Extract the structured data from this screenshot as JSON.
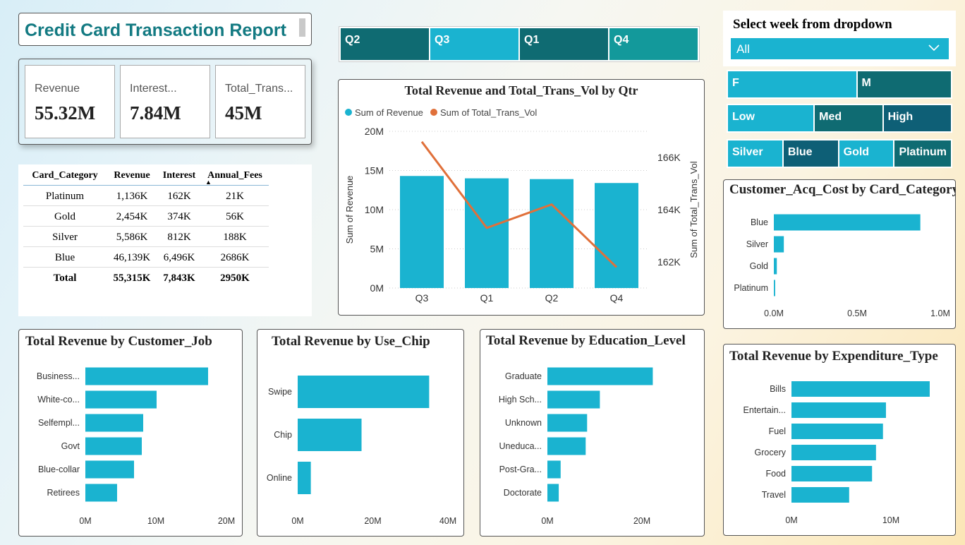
{
  "title": "Credit Card Transaction Report",
  "kpis": [
    {
      "label": "Revenue",
      "value": "55.32M"
    },
    {
      "label": "Interest...",
      "value": "7.84M"
    },
    {
      "label": "Total_Trans...",
      "value": "45M"
    }
  ],
  "matrix": {
    "headers": [
      "Card_Category",
      "Revenue",
      "Interest",
      "Annual_Fees"
    ],
    "sort_indicator": "▲",
    "rows": [
      [
        "Platinum",
        "1,136K",
        "162K",
        "21K"
      ],
      [
        "Gold",
        "2,454K",
        "374K",
        "56K"
      ],
      [
        "Silver",
        "5,586K",
        "812K",
        "188K"
      ],
      [
        "Blue",
        "46,139K",
        "6,496K",
        "2686K"
      ]
    ],
    "total": [
      "Total",
      "55,315K",
      "7,843K",
      "2950K"
    ]
  },
  "quarter_slicer": [
    {
      "label": "Q2",
      "color": "#0f6b72"
    },
    {
      "label": "Q3",
      "color": "#1ab3d0"
    },
    {
      "label": "Q1",
      "color": "#0f6b72"
    },
    {
      "label": "Q4",
      "color": "#13999b"
    }
  ],
  "week_filter": {
    "title": "Select week from dropdown",
    "selected": "All"
  },
  "gender_slicer": [
    {
      "label": "F",
      "color": "#1ab3d0"
    },
    {
      "label": "M",
      "color": "#0f6b72"
    }
  ],
  "income_slicer": [
    {
      "label": "Low",
      "color": "#1ab3d0"
    },
    {
      "label": "Med",
      "color": "#0f6b72"
    },
    {
      "label": "High",
      "color": "#0e5f76"
    }
  ],
  "card_slicer": [
    {
      "label": "Silver",
      "color": "#1ab3d0"
    },
    {
      "label": "Blue",
      "color": "#0e5f76"
    },
    {
      "label": "Gold",
      "color": "#1ab3d0"
    },
    {
      "label": "Platinum",
      "color": "#0f6b72"
    }
  ],
  "colors": {
    "bar": "#1ab3d0",
    "line": "#e0703a"
  },
  "chart_data": [
    {
      "id": "combo",
      "type": "bar",
      "title": "Total Revenue and Total_Trans_Vol by Qtr",
      "categories": [
        "Q3",
        "Q1",
        "Q2",
        "Q4"
      ],
      "series": [
        {
          "name": "Sum of Revenue",
          "type": "bar",
          "values": [
            14.3,
            14.0,
            13.9,
            13.4
          ],
          "axis": "left"
        },
        {
          "name": "Sum of Total_Trans_Vol",
          "type": "line",
          "values": [
            166.6,
            163.3,
            164.2,
            161.8
          ],
          "axis": "right"
        }
      ],
      "ylabel": "Sum of Revenue",
      "y2label": "Sum of Total_Trans_Vol",
      "yticks": [
        "0M",
        "5M",
        "10M",
        "15M",
        "20M"
      ],
      "ylim": [
        0,
        20
      ],
      "y2ticks": [
        "162K",
        "164K",
        "166K"
      ],
      "y2lim": [
        161,
        167
      ],
      "legend": "top-left"
    },
    {
      "id": "acq",
      "type": "bar",
      "title": "Customer_Acq_Cost by Card_Category",
      "orientation": "horizontal",
      "categories": [
        "Blue",
        "Silver",
        "Gold",
        "Platinum"
      ],
      "values": [
        0.88,
        0.06,
        0.018,
        0.008
      ],
      "xticks": [
        "0.0M",
        "0.5M",
        "1.0M"
      ],
      "xlim": [
        0,
        1.0
      ]
    },
    {
      "id": "job",
      "type": "bar",
      "title": "Total Revenue by Customer_Job",
      "orientation": "horizontal",
      "categories": [
        "Business...",
        "White-co...",
        "Selfempl...",
        "Govt",
        "Blue-collar",
        "Retirees"
      ],
      "values": [
        17.4,
        10.1,
        8.2,
        8.0,
        6.9,
        4.5
      ],
      "xticks": [
        "0M",
        "10M",
        "20M"
      ],
      "xlim": [
        0,
        20
      ]
    },
    {
      "id": "chip",
      "type": "bar",
      "title": "Total Revenue by Use_Chip",
      "orientation": "horizontal",
      "categories": [
        "Swipe",
        "Chip",
        "Online"
      ],
      "values": [
        35.0,
        17.0,
        3.5
      ],
      "xticks": [
        "0M",
        "20M",
        "40M"
      ],
      "xlim": [
        0,
        40
      ]
    },
    {
      "id": "edu",
      "type": "bar",
      "title": "Total Revenue by Education_Level",
      "orientation": "horizontal",
      "categories": [
        "Graduate",
        "High Sch...",
        "Unknown",
        "Uneduca...",
        "Post-Gra...",
        "Doctorate"
      ],
      "values": [
        22.3,
        11.1,
        8.4,
        8.1,
        2.8,
        2.4
      ],
      "xticks": [
        "0M",
        "20M"
      ],
      "xlim": [
        0,
        20
      ]
    },
    {
      "id": "exp",
      "type": "bar",
      "title": "Total Revenue by Expenditure_Type",
      "orientation": "horizontal",
      "categories": [
        "Bills",
        "Entertain...",
        "Fuel",
        "Grocery",
        "Food",
        "Travel"
      ],
      "values": [
        13.9,
        9.5,
        9.2,
        8.5,
        8.1,
        5.8
      ],
      "xticks": [
        "0M",
        "10M"
      ],
      "xlim": [
        0,
        10
      ]
    }
  ]
}
